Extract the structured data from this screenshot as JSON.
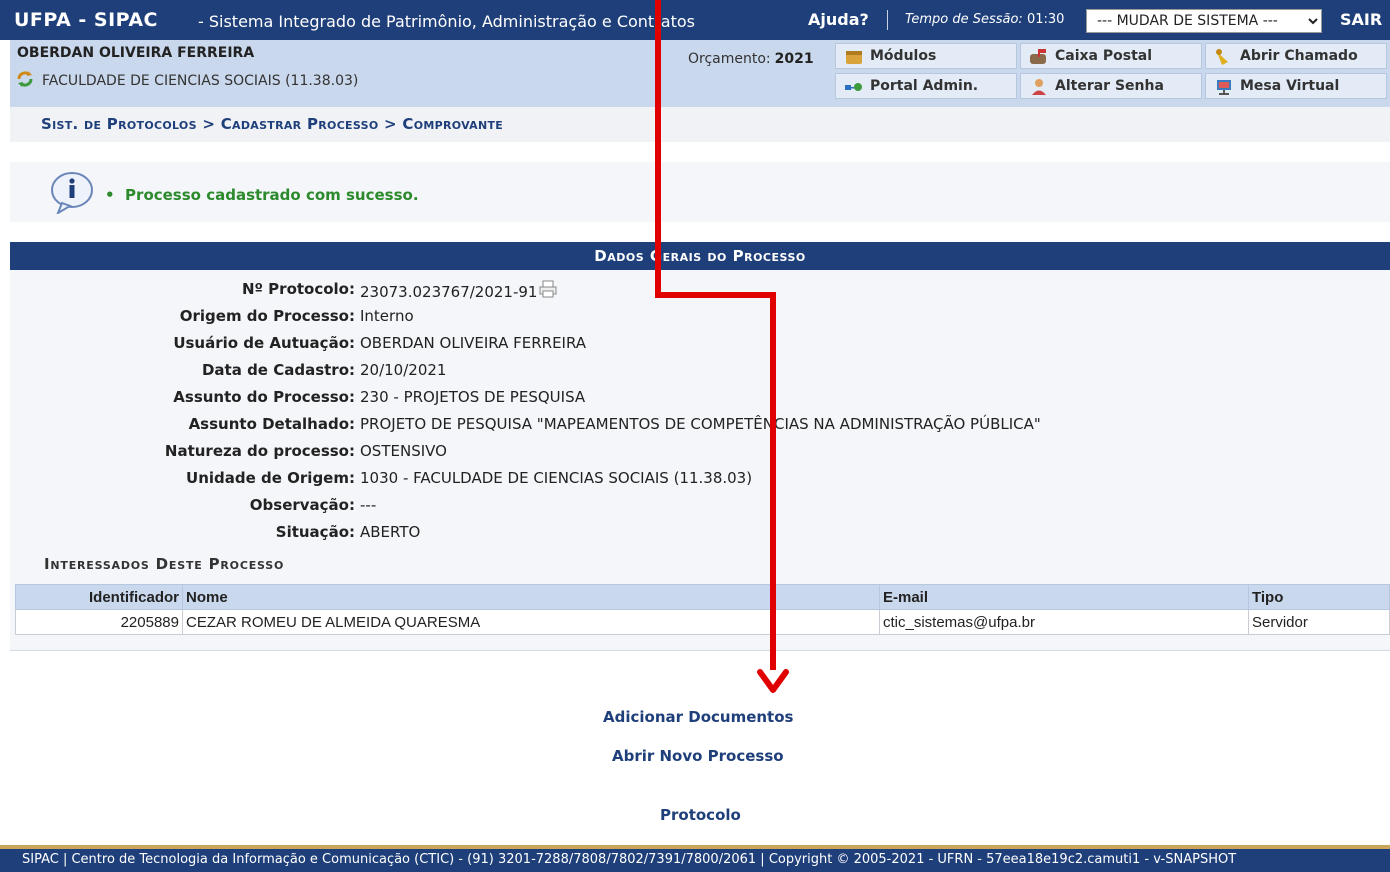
{
  "header": {
    "brand": "UFPA - SIPAC",
    "system_title": "- Sistema Integrado de Patrimônio, Administração e Contratos",
    "help": "Ajuda?",
    "session_label": "Tempo de Sessão:",
    "session_time": "01:30",
    "system_select": "--- MUDAR DE SISTEMA ---",
    "logout": "SAIR"
  },
  "user": {
    "name": "OBERDAN OLIVEIRA FERREIRA",
    "unit": "FACULDADE DE CIENCIAS SOCIAIS (11.38.03)",
    "budget_label": "Orçamento:",
    "budget_year": "2021"
  },
  "menu": {
    "modules": "Módulos",
    "mailbox": "Caixa Postal",
    "open_ticket": "Abrir Chamado",
    "admin_portal": "Portal Admin.",
    "change_password": "Alterar Senha",
    "virtual_desk": "Mesa Virtual"
  },
  "breadcrumb": "Sist. de Protocolos > Cadastrar Processo > Comprovante",
  "message": "Processo cadastrado com sucesso.",
  "process": {
    "title": "Dados Gerais do Processo",
    "fields": [
      {
        "label": "Nº Protocolo:",
        "value": "23073.023767/2021-91"
      },
      {
        "label": "Origem do Processo:",
        "value": "Interno"
      },
      {
        "label": "Usuário de Autuação:",
        "value": "OBERDAN OLIVEIRA FERREIRA"
      },
      {
        "label": "Data de Cadastro:",
        "value": "20/10/2021"
      },
      {
        "label": "Assunto do Processo:",
        "value": "230 - PROJETOS DE PESQUISA"
      },
      {
        "label": "Assunto Detalhado:",
        "value": "PROJETO DE PESQUISA \"MAPEAMENTOS DE COMPETÊNCIAS NA ADMINISTRAÇÃO PÚBLICA\""
      },
      {
        "label": "Natureza do processo:",
        "value": "OSTENSIVO"
      },
      {
        "label": "Unidade de Origem:",
        "value": "1030 - FACULDADE DE CIENCIAS SOCIAIS (11.38.03)"
      },
      {
        "label": "Observação:",
        "value": "---"
      },
      {
        "label": "Situação:",
        "value": "ABERTO"
      }
    ]
  },
  "interested": {
    "title": "Interessados Deste Processo",
    "columns": [
      "Identificador",
      "Nome",
      "E-mail",
      "Tipo"
    ],
    "rows": [
      [
        "2205889",
        "CEZAR ROMEU DE ALMEIDA QUARESMA",
        "ctic_sistemas@ufpa.br",
        "Servidor"
      ]
    ]
  },
  "actions": {
    "add_documents": "Adicionar Documentos",
    "new_process": "Abrir Novo Processo",
    "protocol": "Protocolo"
  },
  "footer": "SIPAC | Centro de Tecnologia da Informação e Comunicação (CTIC) - (91) 3201-7288/7808/7802/7391/7800/2061 | Copyright © 2005-2021 - UFRN - 57eea18e19c2.camuti1 - v-SNAPSHOT",
  "colors": {
    "primary": "#1f3f7a",
    "info_bar": "#c9d8ec",
    "success": "#2c8a2c",
    "annotation_arrow": "#e00000"
  }
}
